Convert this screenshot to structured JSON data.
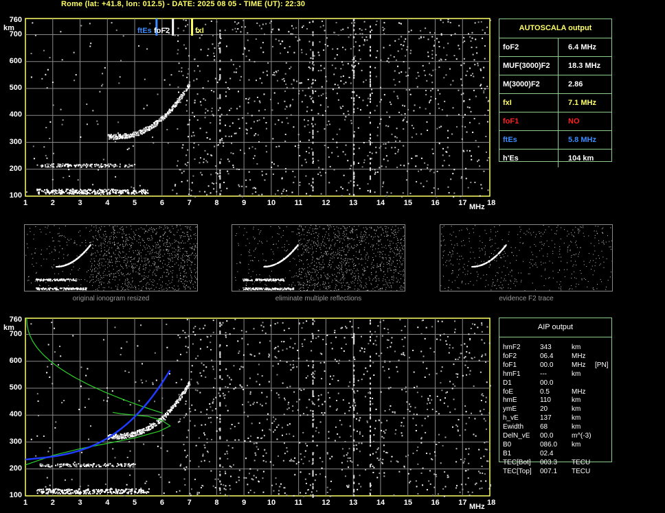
{
  "header": {
    "title": "Rome (lat: +41.8, lon: 012.5) - DATE: 2025 08 05 - TIME (UT): 22:30"
  },
  "axes": {
    "x_ticks": [
      "1",
      "2",
      "3",
      "4",
      "5",
      "6",
      "7",
      "8",
      "9",
      "10",
      "11",
      "12",
      "13",
      "14",
      "15",
      "16",
      "17",
      "18"
    ],
    "x_unit": "MHz",
    "y_ticks_main": [
      "100",
      "200",
      "300",
      "400",
      "500",
      "600",
      "700"
    ],
    "y_top": "760",
    "y_unit": "km"
  },
  "markers": {
    "ftes": "ftEs",
    "fof2": "foF2",
    "fxi": "fxI"
  },
  "autoscala": {
    "title": "AUTOSCALA output",
    "rows": [
      {
        "key": "foF2",
        "value": "6.4  MHz",
        "color": "#ffffff"
      },
      {
        "key": "MUF(3000)F2",
        "value": "18.3 MHz",
        "color": "#ffffff"
      },
      {
        "key": "M(3000)F2",
        "value": "2.86",
        "color": "#ffffff"
      },
      {
        "key": "fxI",
        "value": "7.1  MHz",
        "color": "#ffff66"
      },
      {
        "key": "foF1",
        "value": "NO",
        "color": "#ff2020"
      },
      {
        "key": "ftEs",
        "value": "5.8 MHz",
        "color": "#3a8cff"
      },
      {
        "key": "h'Es",
        "value": "104    km",
        "color": "#ffffff"
      }
    ]
  },
  "thumbs": {
    "captions": [
      "original ionogram resized",
      "eliminate multiple reflections",
      "evidence F2 trace"
    ]
  },
  "aip": {
    "title": "AIP output",
    "rows": [
      {
        "k": "hmF2",
        "v": "343",
        "u": "km",
        "x": ""
      },
      {
        "k": "foF2",
        "v": "06.4",
        "u": "MHz",
        "x": ""
      },
      {
        "k": "foF1",
        "v": "00.0",
        "u": "MHz",
        "x": "[PN]"
      },
      {
        "k": "hmF1",
        "v": "---",
        "u": "km",
        "x": ""
      },
      {
        "k": "D1",
        "v": "00.0",
        "u": "",
        "x": ""
      },
      {
        "k": "foE",
        "v": "0.5",
        "u": "MHz",
        "x": ""
      },
      {
        "k": "hmE",
        "v": "110",
        "u": "km",
        "x": ""
      },
      {
        "k": "ymE",
        "v": "20",
        "u": "km",
        "x": ""
      },
      {
        "k": "h_vE",
        "v": "137",
        "u": "km",
        "x": ""
      },
      {
        "k": "Ewidth",
        "v": "68",
        "u": "km",
        "x": ""
      },
      {
        "k": "DelN_vE",
        "v": "00.0",
        "u": "m^(-3)",
        "x": ""
      },
      {
        "k": "B0",
        "v": "086.0",
        "u": "km",
        "x": ""
      },
      {
        "k": "B1",
        "v": "02.4",
        "u": "",
        "x": ""
      },
      {
        "k": "TEC[Bot]",
        "v": "003.3",
        "u": "TECU",
        "x": ""
      },
      {
        "k": "TEC[Top]",
        "v": "007.1",
        "u": "TECU",
        "x": ""
      }
    ]
  },
  "colors": {
    "grid": "#8a8a8a",
    "frame": "#ffff66",
    "table_border": "#8fd08f",
    "profile": "#2bd42b",
    "blue_trace": "#1f3cff"
  }
}
